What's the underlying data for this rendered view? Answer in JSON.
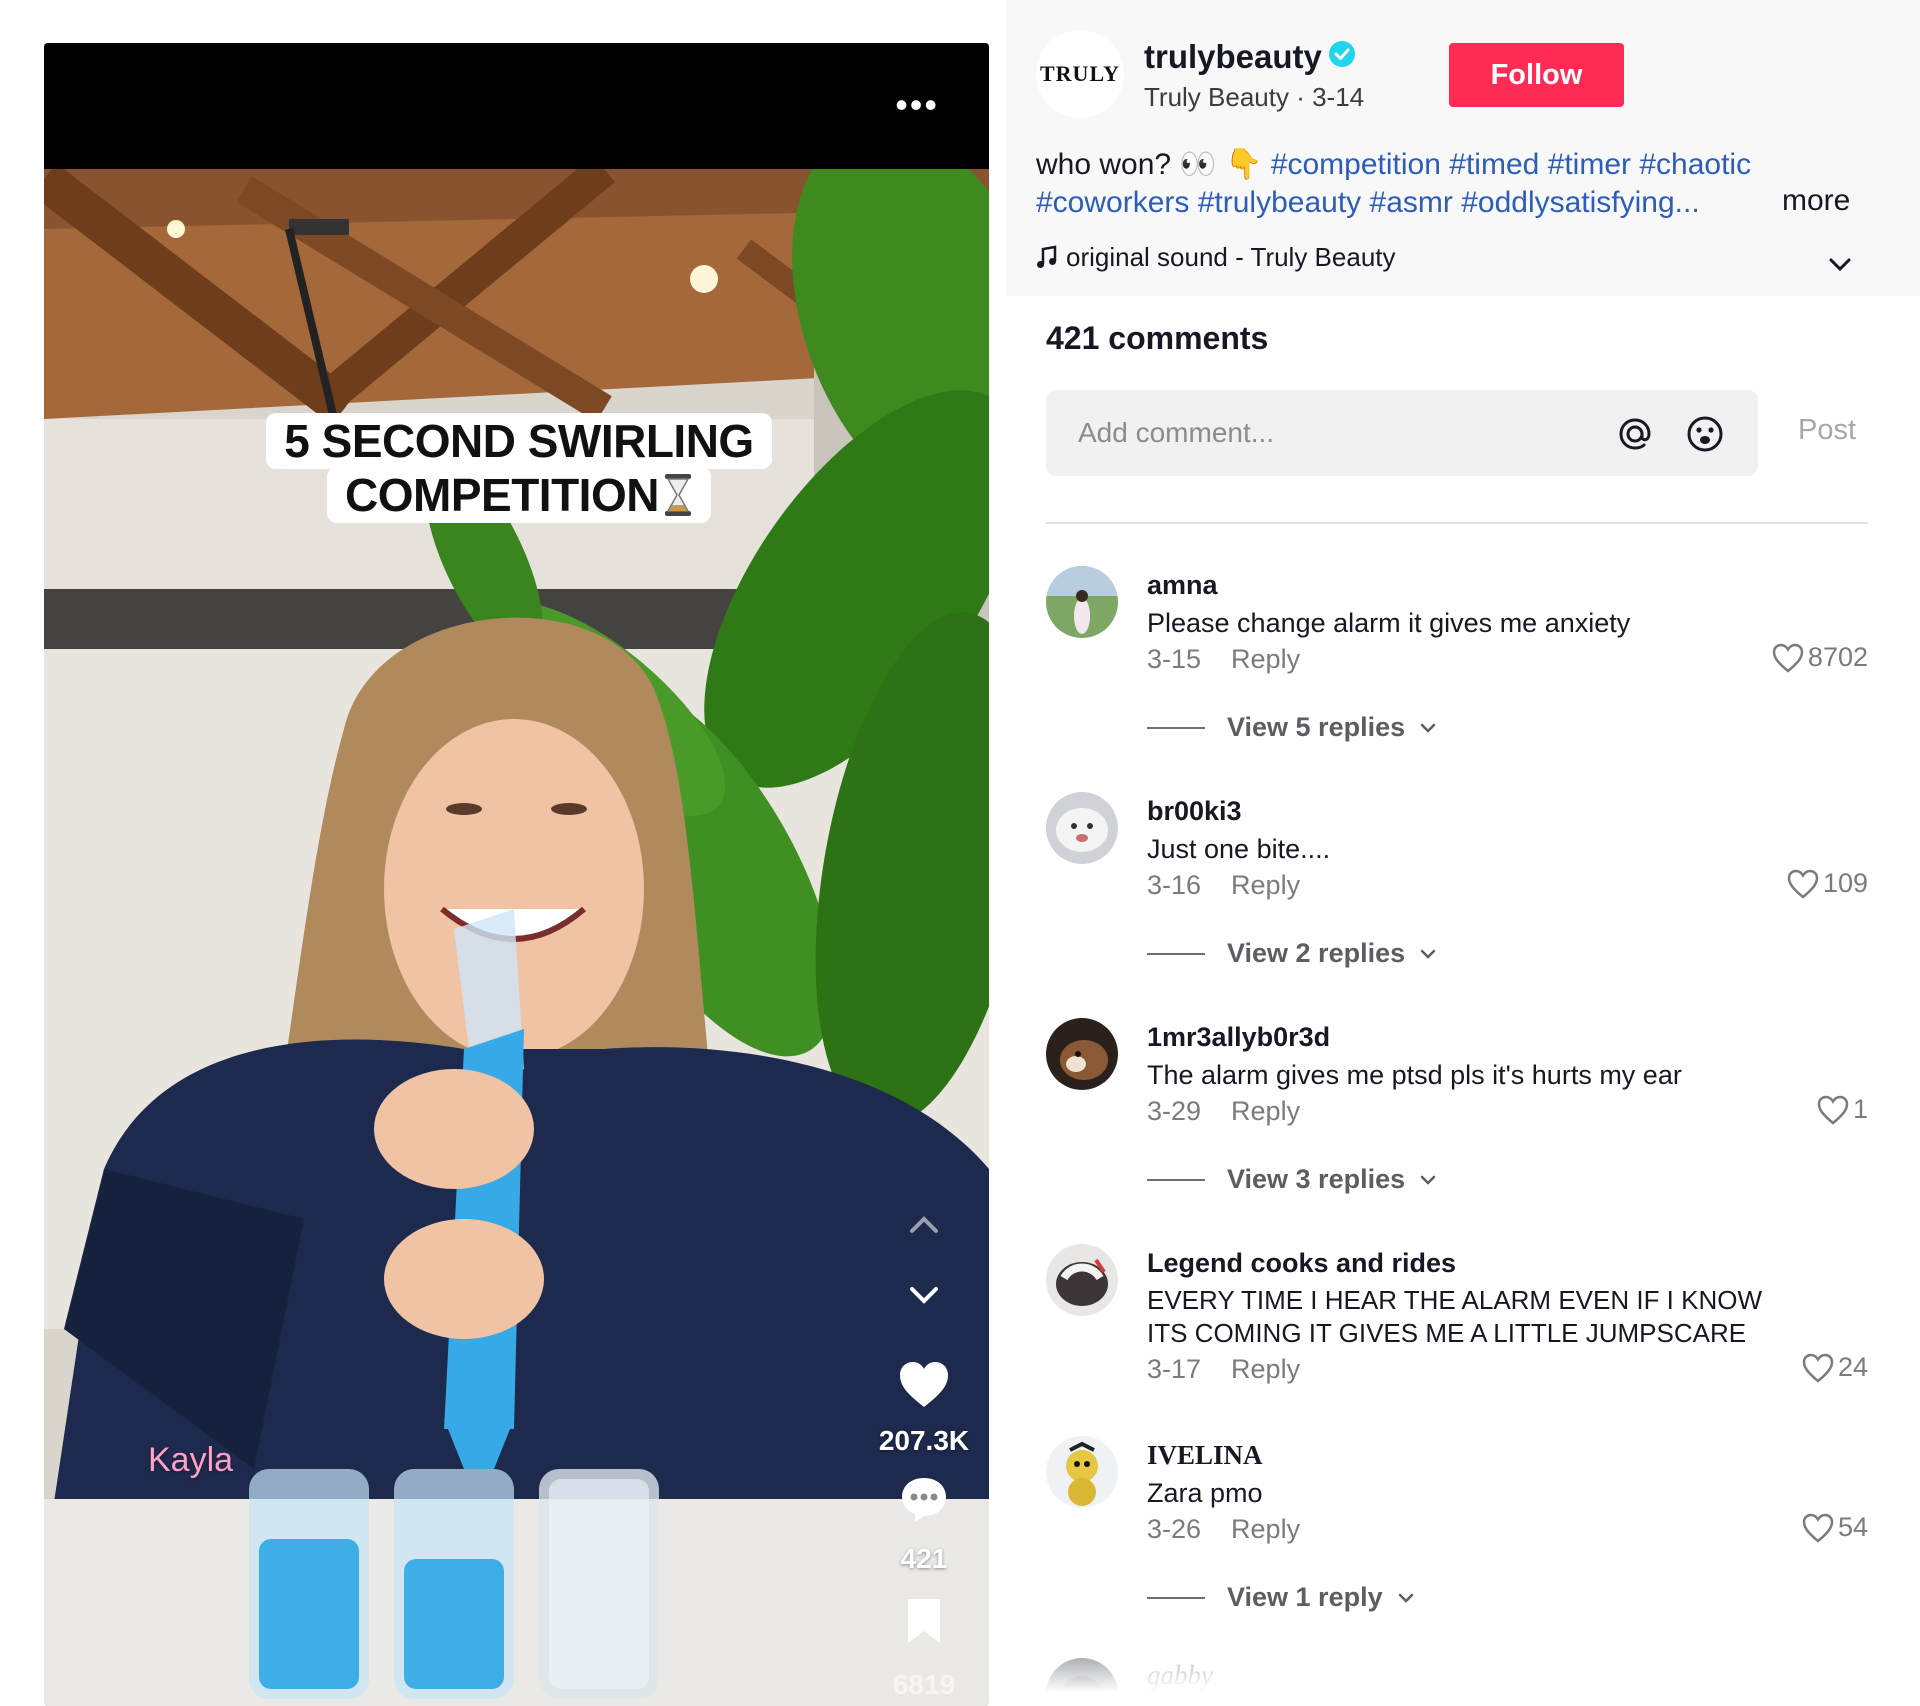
{
  "video": {
    "caption_line_1": "5 SECOND SWIRLING",
    "caption_line_2": "COMPETITION",
    "name_tag": "Kayla",
    "like_count": "207.3K",
    "comment_count": "421",
    "save_count": "6819",
    "more_glyph": "•••"
  },
  "author": {
    "avatar_text": "TRULY",
    "username": "trulybeauty",
    "display_name": "Truly Beauty",
    "date": "3-14",
    "follow_label": "Follow"
  },
  "description": {
    "text": "who won? 👀 👇",
    "hashtags_line_1": [
      "#competition",
      "#timed",
      "#timer",
      "#chaotic"
    ],
    "hashtags_line_2": [
      "#coworkers",
      "#trulybeauty",
      "#asmr",
      "#oddlysatisfying..."
    ],
    "more_label": "more",
    "sound": "original sound - Truly Beauty"
  },
  "comments_section": {
    "title": "421 comments",
    "input_placeholder": "Add comment...",
    "post_label": "Post",
    "reply_label": "Reply"
  },
  "comments": [
    {
      "user": "amna",
      "text": "Please change alarm it gives me anxiety",
      "date": "3-15",
      "likes": "8702",
      "view_replies": "View 5 replies"
    },
    {
      "user": "br00ki3",
      "text": "Just one bite....",
      "date": "3-16",
      "likes": "109",
      "view_replies": "View 2 replies"
    },
    {
      "user": "1mr3allyb0r3d",
      "text": "The alarm gives me ptsd pls it's hurts my ear",
      "date": "3-29",
      "likes": "1",
      "view_replies": "View 3 replies"
    },
    {
      "user": "Legend cooks and rides",
      "text": "EVERY TIME I HEAR THE ALARM EVEN IF I KNOW ITS COMING IT GIVES  ME A LITTLE JUMPSCARE",
      "date": "3-17",
      "likes": "24",
      "view_replies": ""
    },
    {
      "user": "IVELINA",
      "text": "Zara pmo",
      "date": "3-26",
      "likes": "54",
      "view_replies": "View 1 reply"
    },
    {
      "user": "gabby",
      "text": "",
      "date": "",
      "likes": "",
      "view_replies": ""
    }
  ],
  "colors": {
    "follow": "#fe2c55",
    "hashtag": "#2b5db9",
    "verified": "#20d5ec",
    "panel_top": "#f8f8f8"
  },
  "icons": [
    "more-dots-icon",
    "chevron-up-icon",
    "chevron-down-icon",
    "heart-icon",
    "comment-icon",
    "bookmark-icon",
    "verified-icon",
    "music-note-icon",
    "at-icon",
    "emoji-icon",
    "hourglass-icon"
  ]
}
